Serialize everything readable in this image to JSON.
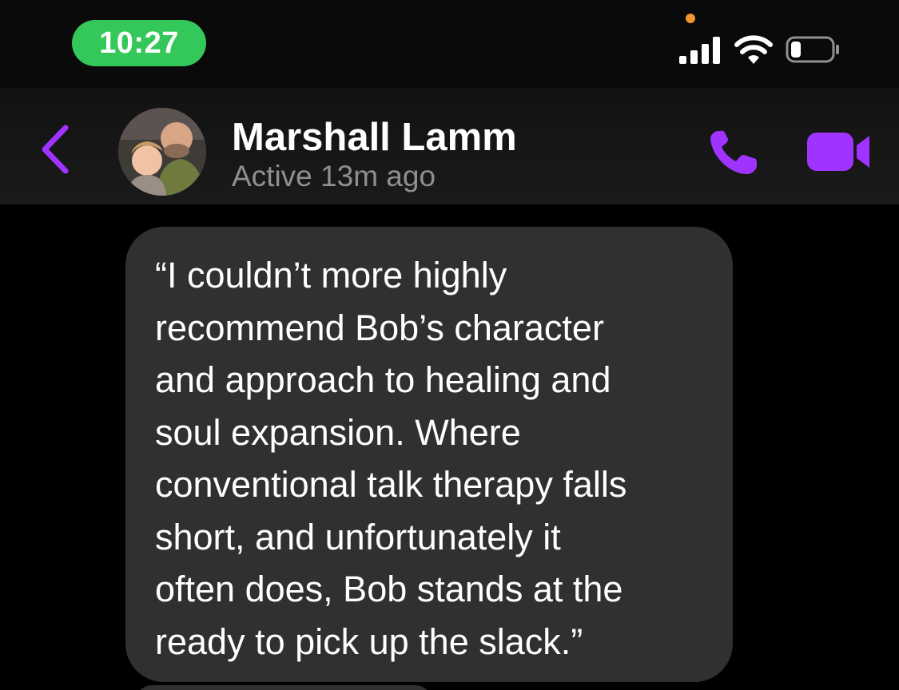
{
  "status_bar": {
    "time": "10:27",
    "time_pill_color": "#34c759",
    "privacy_dot_color": "#f0962e",
    "icons": [
      "signal-icon",
      "wifi-icon",
      "battery-icon"
    ]
  },
  "header": {
    "back_icon": "chevron-left-icon",
    "contact_name": "Marshall Lamm",
    "contact_status": "Active 13m ago",
    "call_icon": "phone-icon",
    "video_icon": "video-camera-icon",
    "accent_color": "#a033ff"
  },
  "messages": [
    {
      "text": "“I couldn’t more highly\nrecommend Bob’s character\nand approach to healing and\nsoul expansion. Where\nconventional talk therapy falls\nshort, and unfortunately it\noften does, Bob stands at the\nready to pick up the slack.”"
    }
  ]
}
